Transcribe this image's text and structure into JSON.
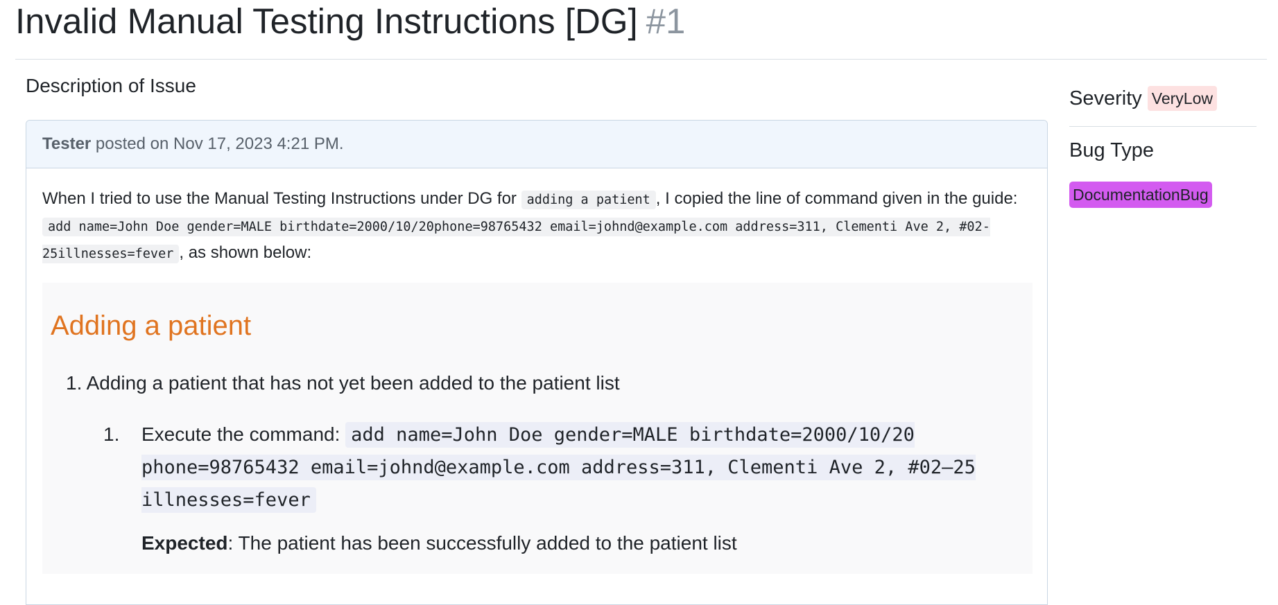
{
  "issue": {
    "title": "Invalid Manual Testing Instructions [DG]",
    "number": "#1"
  },
  "description": {
    "heading": "Description of Issue",
    "author": "Tester",
    "posted_text": " posted on Nov 17, 2023 4:21 PM.",
    "body": {
      "text_1": "When I tried to use the Manual Testing Instructions under DG for ",
      "code_1": "adding a patient",
      "text_2": ", I copied the line of command given in the guide: ",
      "code_2": "add name=John Doe gender=MALE birthdate=2000/10/20phone=98765432 email=johnd@example.com address=311, Clementi Ave 2, #02-25illnesses=fever",
      "text_3": ", as shown below:"
    }
  },
  "screenshot_excerpt": {
    "heading": "Adding a patient",
    "item_1_marker": "1.",
    "item_1": "Adding a patient that has not yet been added to the patient list",
    "item_1_1_marker": "1.",
    "item_1_1_label": "Execute the command: ",
    "item_1_1_command": "add name=John Doe gender=MALE birthdate=2000/10/20 phone=98765432 email=johnd@example.com address=311, Clementi Ave 2, #02–25 illnesses=fever",
    "expected_label": "Expected",
    "expected_text": ": The patient has been successfully added to the patient list"
  },
  "sidebar": {
    "severity_label": "Severity",
    "severity_value": "VeryLow",
    "bug_type_label": "Bug Type",
    "bug_type_value": "DocumentationBug"
  },
  "colors": {
    "excerpt_heading": "#e07420",
    "severity_badge": "#fde1e1",
    "bug_type_badge": "#d35bf0",
    "comment_header_bg": "#f0f6fd"
  }
}
